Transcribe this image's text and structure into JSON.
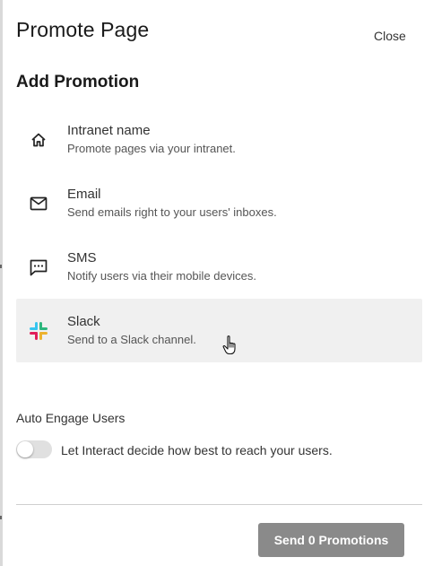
{
  "header": {
    "title": "Promote Page",
    "close_label": "Close"
  },
  "section": {
    "title": "Add Promotion"
  },
  "promotions": [
    {
      "name": "Intranet name",
      "description": "Promote pages via your intranet.",
      "icon": "home-icon"
    },
    {
      "name": "Email",
      "description": "Send emails right to your users' inboxes.",
      "icon": "envelope-icon"
    },
    {
      "name": "SMS",
      "description": "Notify users via their mobile devices.",
      "icon": "chat-bubble-icon"
    },
    {
      "name": "Slack",
      "description": "Send to a Slack channel.",
      "icon": "slack-icon"
    }
  ],
  "auto_engage": {
    "title": "Auto Engage Users",
    "toggle_label": "Let Interact decide how best to reach your users.",
    "enabled": false
  },
  "footer": {
    "send_label": "Send 0 Promotions"
  },
  "colors": {
    "button_bg": "#8a8a8a",
    "hover_bg": "#f0f0f0",
    "slack_blue": "#36c5f0",
    "slack_green": "#2eb67d",
    "slack_yellow": "#ecb22e",
    "slack_red": "#e01e5a"
  }
}
